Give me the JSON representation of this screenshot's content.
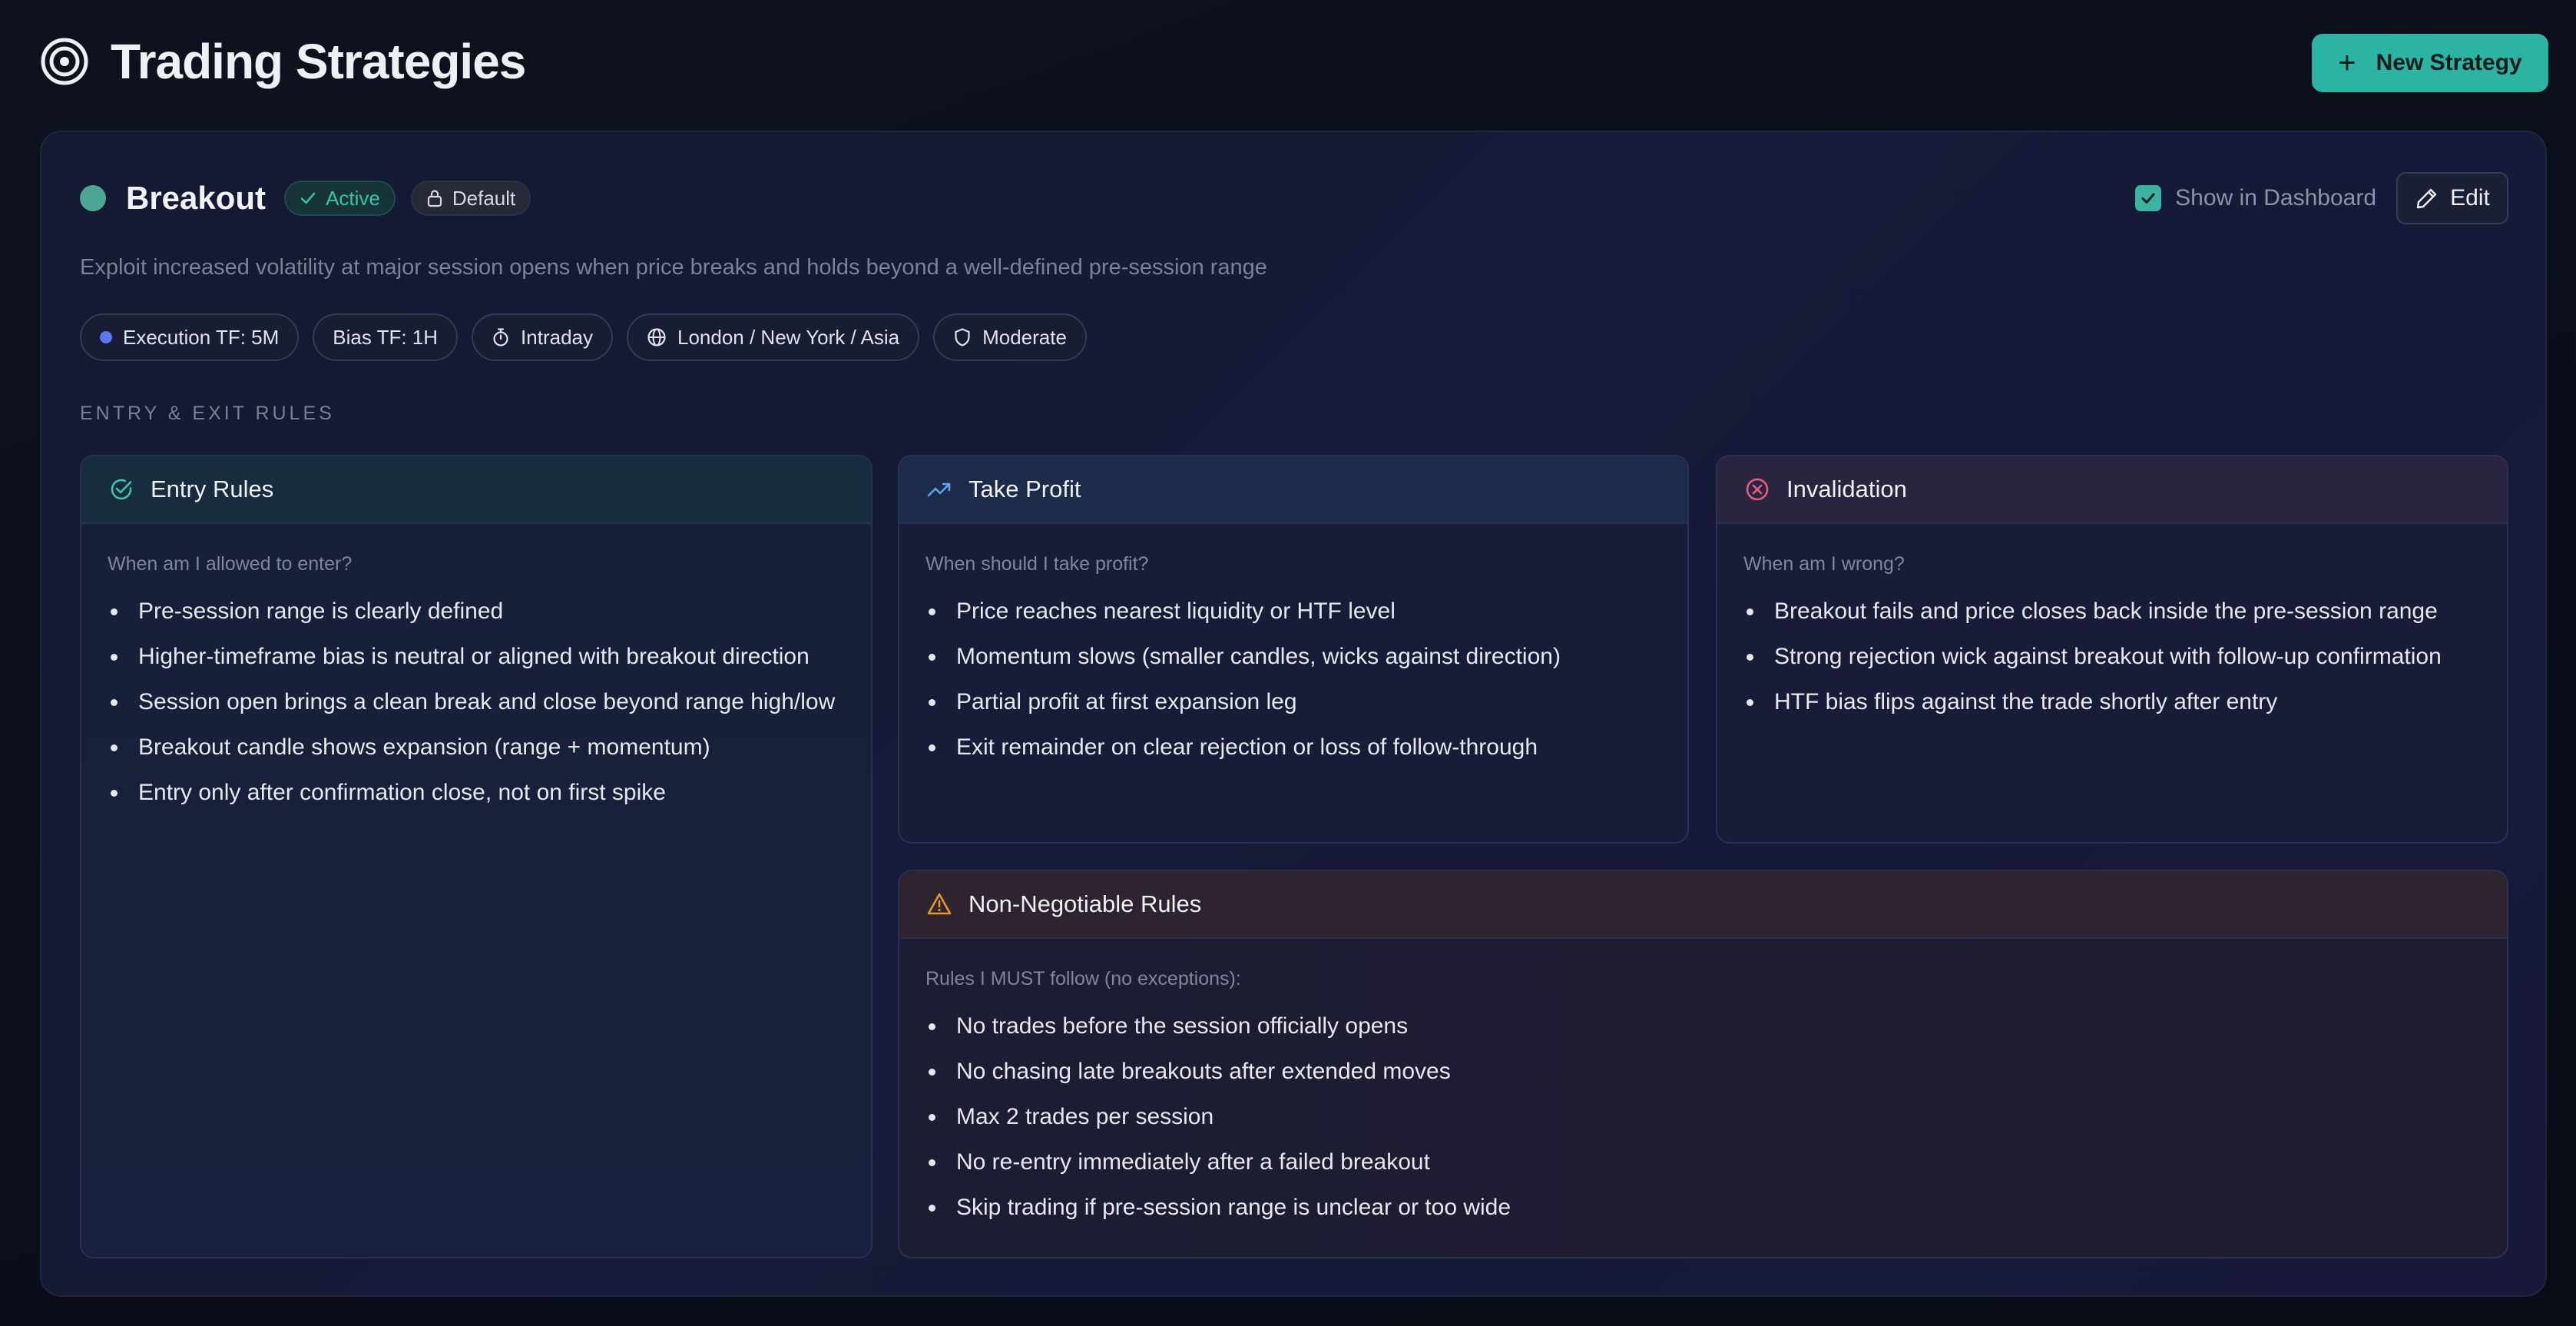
{
  "header": {
    "title": "Trading Strategies",
    "new_button_label": "New Strategy"
  },
  "strategy": {
    "name": "Breakout",
    "status_badge": "Active",
    "default_badge": "Default",
    "show_in_dashboard_label": "Show in Dashboard",
    "show_in_dashboard_checked": true,
    "edit_label": "Edit",
    "description": "Exploit increased volatility at major session opens when price breaks and holds beyond a well-defined pre-session range",
    "chips": [
      {
        "label": "Execution TF: 5M",
        "icon": "blue-dot"
      },
      {
        "label": "Bias TF: 1H",
        "icon": ""
      },
      {
        "label": "Intraday",
        "icon": "stopwatch-icon"
      },
      {
        "label": "London / New York / Asia",
        "icon": "globe-icon"
      },
      {
        "label": "Moderate",
        "icon": "shield-icon"
      }
    ]
  },
  "rules": {
    "section_label": "ENTRY & EXIT RULES",
    "entry": {
      "title": "Entry Rules",
      "prompt": "When am I allowed to enter?",
      "items": [
        "Pre-session range is clearly defined",
        "Higher-timeframe bias is neutral or aligned with breakout direction",
        "Session open brings a clean break and close beyond range high/low",
        "Breakout candle shows expansion (range + momentum)",
        "Entry only after confirmation close, not on first spike"
      ]
    },
    "take_profit": {
      "title": "Take Profit",
      "prompt": "When should I take profit?",
      "items": [
        "Price reaches nearest liquidity or HTF level",
        "Momentum slows (smaller candles, wicks against direction)",
        "Partial profit at first expansion leg",
        "Exit remainder on clear rejection or loss of follow-through"
      ]
    },
    "invalidation": {
      "title": "Invalidation",
      "prompt": "When am I wrong?",
      "items": [
        "Breakout fails and price closes back inside the pre-session range",
        "Strong rejection wick against breakout with follow-up confirmation",
        "HTF bias flips against the trade shortly after entry"
      ]
    },
    "non_negotiable": {
      "title": "Non-Negotiable Rules",
      "prompt": "Rules I MUST follow (no exceptions):",
      "items": [
        "No trades before the session officially opens",
        "No chasing late breakouts after extended moves",
        "Max 2 trades per session",
        "No re-entry immediately after a failed breakout",
        "Skip trading if pre-session range is unclear or too wide"
      ]
    }
  },
  "colors": {
    "accent_teal": "#2bb3a3",
    "entry_icon": "#3cc4a8",
    "take_profit_icon": "#5aa8e8",
    "invalidation_icon": "#e0607a",
    "non_negotiable_icon": "#e8962e"
  }
}
